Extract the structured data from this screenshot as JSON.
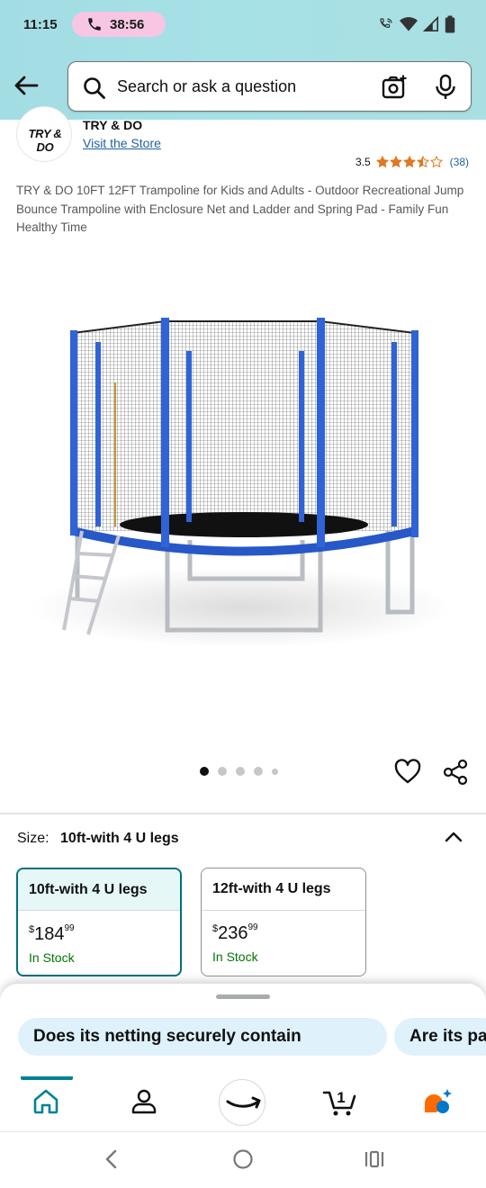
{
  "status_bar": {
    "time": "11:15",
    "call_duration": "38:56"
  },
  "search": {
    "placeholder": "Search or ask a question"
  },
  "brand": {
    "logo_text": "TRY & DO",
    "name": "TRY & DO",
    "visit_link": "Visit the Store"
  },
  "rating": {
    "value": "3.5",
    "stars": 3.5,
    "count": "(38)"
  },
  "product": {
    "title": "TRY & DO 10FT 12FT Trampoline for Kids and Adults - Outdoor Recreational Jump Bounce Trampoline with Enclosure Net and Ladder and Spring Pad - Family Fun Healthy Time",
    "image_count": 5,
    "active_image": 1
  },
  "size": {
    "label": "Size:",
    "selected": "10ft-with 4 U legs",
    "options": [
      {
        "name": "10ft-with 4 U legs",
        "currency": "$",
        "whole": "184",
        "fraction": "99",
        "stock": "In Stock"
      },
      {
        "name": "12ft-with 4 U legs",
        "currency": "$",
        "whole": "236",
        "fraction": "99",
        "stock": "In Stock"
      }
    ]
  },
  "suggestions": [
    "Does its netting securely contain",
    "Are its pa"
  ],
  "nav": {
    "items": [
      "home",
      "account",
      "amazon",
      "cart",
      "rufus"
    ],
    "cart_count": "1"
  },
  "colors": {
    "header_bg": "#a6e1e6",
    "link": "#2162a1",
    "star": "#de7921",
    "in_stock": "#007600",
    "selected_border": "#00707a",
    "chip_bg": "#dff1fb",
    "nav_indicator": "#008296"
  }
}
